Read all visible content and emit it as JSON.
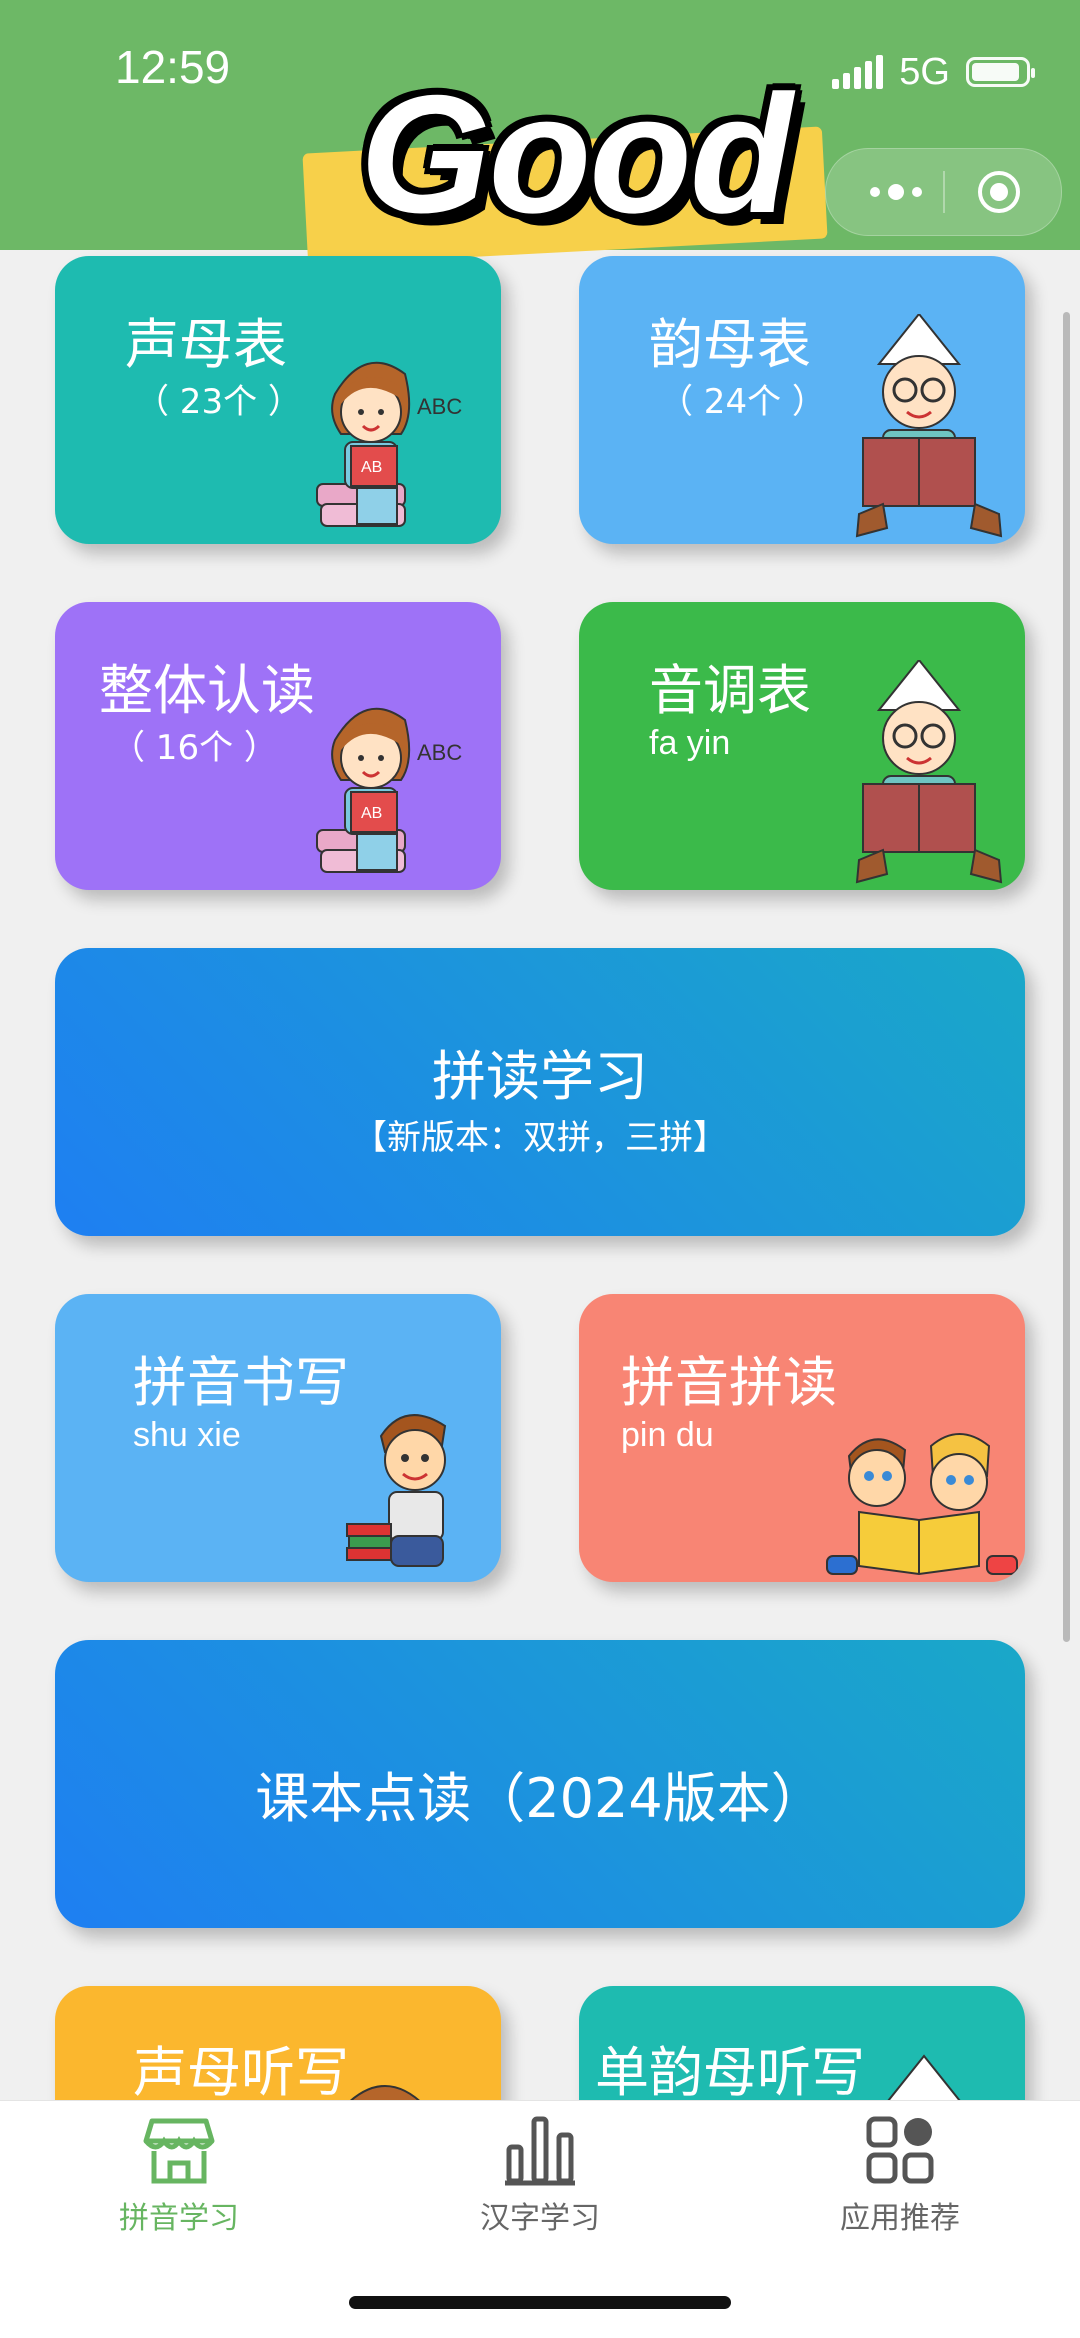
{
  "status_bar": {
    "time": "12:59",
    "network": "5G"
  },
  "header": {
    "banner_text": "Good"
  },
  "cards": {
    "shengmu": {
      "title": "声母表",
      "sub": "（ 23个 ）",
      "color": "#1ebbb0"
    },
    "yunmu": {
      "title": "韵母表",
      "sub": "（ 24个 ）",
      "color": "#5bb3f4"
    },
    "zhengti": {
      "title": "整体认读",
      "sub": "（ 16个 ）",
      "color": "#9e72f7"
    },
    "yindiao": {
      "title": "音调表",
      "sub": "fa yin",
      "color": "#3bba4a"
    },
    "pindu_study": {
      "title": "拼读学习",
      "sub": "【新版本：双拼，三拼】"
    },
    "pinyin_write": {
      "title": "拼音书写",
      "sub": "shu xie",
      "color": "#5bb3f4"
    },
    "pinyin_read": {
      "title": "拼音拼读",
      "sub": "pin du",
      "color": "#f88574"
    },
    "textbook": {
      "title": "课本点读（2024版本）"
    },
    "shengmu_dictation": {
      "title": "声母听写",
      "color": "#fbb72e"
    },
    "yunmu_dictation": {
      "title": "单韵母听写",
      "color": "#1ebbb0"
    }
  },
  "tabbar": {
    "tabs": [
      {
        "label": "拼音学习",
        "active": true
      },
      {
        "label": "汉字学习",
        "active": false
      },
      {
        "label": "应用推荐",
        "active": false
      }
    ]
  },
  "colors": {
    "header_green": "#6db866",
    "active_tab": "#67b561"
  }
}
